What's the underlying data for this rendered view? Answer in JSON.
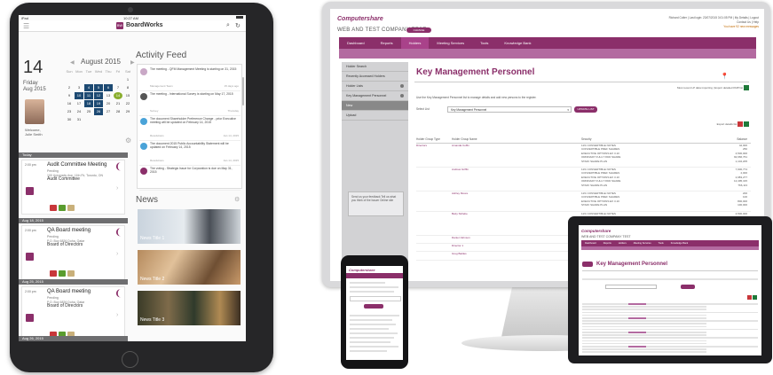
{
  "ipad": {
    "status_left": "iPad",
    "status_time": "10:27 AM",
    "app_logo": "BW",
    "app_title": "BoardWorks",
    "day_number": "14",
    "day_name": "Friday",
    "day_date": "Aug 2015",
    "month_label": "August 2015",
    "weekdays": [
      "Sun",
      "Mon",
      "Tue",
      "Wed",
      "Thu",
      "Fri",
      "Sat"
    ],
    "calendar_rows": [
      [
        "",
        "",
        "",
        "",
        "",
        "",
        "1"
      ],
      [
        "2",
        "3",
        "4",
        "5",
        "6",
        "7",
        "8"
      ],
      [
        "9",
        "10",
        "11",
        "12",
        "13",
        "14",
        "15"
      ],
      [
        "16",
        "17",
        "18",
        "19",
        "20",
        "21",
        "22"
      ],
      [
        "23",
        "24",
        "25",
        "26",
        "27",
        "28",
        "29"
      ],
      [
        "30",
        "31",
        "",
        "",
        "",
        "",
        ""
      ]
    ],
    "welcome": "Welcome,",
    "user_name": "Julie Smith",
    "agenda": [
      {
        "date": "Today",
        "time": "2:00 pm",
        "title": "Audit Committee Meeting",
        "status": "Pending",
        "location": "100 University Ave, 11th Flr, Toronto, ON",
        "group": "Audit Committee"
      },
      {
        "date": "Aug 18, 2015",
        "time": "2:00 pm",
        "title": "QA Board meeting",
        "status": "Pending",
        "location": "P.O. Box 6826 Doha, Qatar",
        "group": "Board of Directors"
      },
      {
        "date": "Aug 25, 2015",
        "time": "2:00 pm",
        "title": "QA Board meeting",
        "status": "Pending",
        "location": "P.O. Box 6826 Doha, Qatar",
        "group": "Board of Directors"
      },
      {
        "date": "Aug 26, 2015",
        "time": "",
        "title": "",
        "status": "",
        "location": "",
        "group": ""
      }
    ],
    "activity_title": "Activity Feed",
    "activity": [
      {
        "text": "The meeting - QFM Management Meeting is starting on 31, 2015",
        "meta": "Management Team",
        "when": "15 days ago"
      },
      {
        "text": "The meeting - International Survey is starting on May 17, 2015",
        "meta": "Survey",
        "when": "Thursday"
      },
      {
        "text": "The document Shareholder Preference Change - prior Executive meeting will be updated on February 14, 2015",
        "meta": "Resolutions",
        "when": "Jan 14, 2015"
      },
      {
        "text": "The document 2015 Public Accountability Statement will be updated on February 14, 2015",
        "meta": "Resolutions",
        "when": "Jan 14, 2015"
      },
      {
        "text": "The voting - Strategic Issue for Corporation is due on May 31, 2015",
        "meta": "",
        "when": ""
      }
    ],
    "news_title": "News",
    "news": [
      "News Title 1",
      "News Title 2",
      "News Title 3"
    ]
  },
  "desktop": {
    "logo": "Computershare",
    "company": "WEB AND TEST COMPANY TEST",
    "company_badge": "CHANGE COMPANY",
    "top_right_user": "Richard Colter | Last login: 23/07/2015 3:01:05 PM | My Details | Logout",
    "top_right_contact": "Contact Us | Help",
    "top_right_msg": "You have 92 new messages",
    "nav": [
      "Dashboard",
      "Reports",
      "Holders",
      "Meeting Services",
      "Tools",
      "Knowledge Bank"
    ],
    "nav_active": "Holders",
    "sidebar": [
      "Holder Search",
      "Recently Accessed Holders",
      "Holder Lists",
      "Key Management Personnel",
      "New",
      "Upload"
    ],
    "sidebar_selected": "New",
    "sidebar_box": "Send us your feedback\nTell us what you think of the Issuer Online site",
    "page_title": "Key Management Personnel",
    "export_top": "Most recent LP data importing | Export detailed KMP list",
    "description": "Use the Key Management Personnel list to manage details and add new persons to the register.",
    "select_label": "Select List",
    "select_value": "Key Management Personnel",
    "select_button": "UPDATE LIST",
    "export_label": "Export details list",
    "columns": [
      "Holder Group Type",
      "Holder Group Name",
      "Security",
      "Balance"
    ],
    "rows": [
      {
        "group": "Directors",
        "name": "Amanda Coffin",
        "security": [
          "11% CONVERTIBLE NOTES",
          "CONVERTIBLE PREF SHARES",
          "EXECUTIVE OPTIONS EX 3.10",
          "ORDINARY FULLY PAID SHARE",
          "STAFF SHARE PLAN"
        ],
        "balance": [
          "42,000",
          "250",
          "4,500,000",
          "92,966,761",
          "1,102,205"
        ]
      },
      {
        "group": "",
        "name": "Andrew Griffin",
        "security": [
          "11% CONVERTIBLE NOTES",
          "CONVERTIBLE PREF SHARES",
          "EXECUTIVE OPTIONS EX 3.10",
          "ORDINARY FULLY PAID SHARE",
          "STAFF SHARE PLAN"
        ],
        "balance": [
          "7,900,774",
          "2,000",
          "2,983,277",
          "12,495,315",
          "766,113"
        ]
      },
      {
        "group": "",
        "name": "Ashley Moore",
        "security": [
          "11% CONVERTIBLE NOTES",
          "CONVERTIBLE PREF SHARES",
          "EXECUTIVE OPTIONS EX 3.10",
          "STAFF SHARE PLAN"
        ],
        "balance": [
          "200",
          "100",
          "800,000",
          "100,000"
        ]
      },
      {
        "group": "",
        "name": "Betty Strilebe",
        "security": [
          "11% CONVERTIBLE NOTES",
          "11% CONVERTIBLE PREF SHARES",
          "CONVERTIBLE PREF SHARES",
          "EXECUTIVE OPTIONS EX 3.10",
          "STAFF SHARE PLAN"
        ],
        "balance": [
          "4,500,000",
          "120,000",
          "3,467",
          "450,000",
          "97,000"
        ]
      },
      {
        "group": "",
        "name": "Daniel Johnson",
        "security": [],
        "balance": []
      },
      {
        "group": "",
        "name": "Director 1",
        "security": [],
        "balance": []
      },
      {
        "group": "",
        "name": "Greg Battles",
        "security": [],
        "balance": []
      }
    ]
  },
  "laptop": {
    "logo": "Computershare",
    "company": "WEB AND TEST COMPANY TEST",
    "nav": [
      "Dashboard",
      "Reports",
      "Holders",
      "Meeting Services",
      "Tools",
      "Knowledge Bank"
    ],
    "page_title": "Key Management Personnel",
    "back_label": "BACK"
  },
  "phone": {
    "logo": "Computershare"
  },
  "colors": {
    "brand": "#8b2f6a",
    "brand_light": "#b36aa0",
    "calendar_highlight": "#1d4a73",
    "today": "#8aae2f"
  }
}
